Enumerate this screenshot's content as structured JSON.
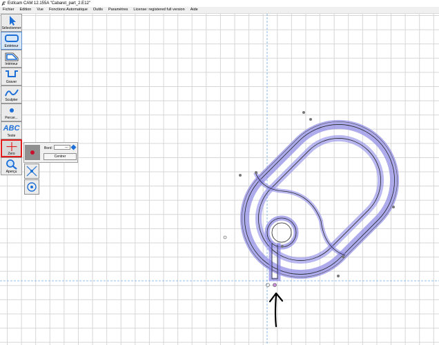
{
  "window": {
    "title": "Estlcam CAM 12.155A \"Cabaret_part_2.E12\"",
    "app_icon": "estlcam-logo-icon"
  },
  "menu": [
    {
      "label": "Fichier"
    },
    {
      "label": "Edition"
    },
    {
      "label": "Vue"
    },
    {
      "label": "Fonctions Automatique"
    },
    {
      "label": "Outils"
    },
    {
      "label": "Paramètres"
    },
    {
      "label": "License: registered full version"
    },
    {
      "label": "Aide"
    }
  ],
  "tools": [
    {
      "id": "selectionner",
      "label": "Sélectionner",
      "icon": "cursor-arrow-icon",
      "active": false
    },
    {
      "id": "exterieur",
      "label": "Extérieur",
      "icon": "outside-contour-icon",
      "active": true
    },
    {
      "id": "interieur",
      "label": "Intérieur",
      "icon": "inside-contour-icon",
      "active": false
    },
    {
      "id": "graver",
      "label": "Graver",
      "icon": "engrave-icon",
      "active": false
    },
    {
      "id": "sculpter",
      "label": "Sculpter",
      "icon": "sculpt-icon",
      "active": false
    },
    {
      "id": "percer",
      "label": "Percer...",
      "icon": "drill-icon",
      "active": false
    },
    {
      "id": "texte",
      "label": "Texte",
      "icon": "text-abc-icon",
      "glyph": "ABC",
      "active": false
    },
    {
      "id": "zero",
      "label": "Zero",
      "icon": "zero-crosshair-icon",
      "active": false,
      "highlighted": true
    },
    {
      "id": "apercu",
      "label": "Aperçu",
      "icon": "magnifier-icon",
      "active": false
    }
  ],
  "zero_panel": {
    "bord_label": "Bord:",
    "bord_value": "---",
    "centrer_label": "Centrer",
    "buttons": [
      {
        "icon": "red-dot-icon",
        "selected": true
      },
      {
        "icon": "cross-diagonal-icon",
        "selected": false
      },
      {
        "icon": "circle-center-icon",
        "selected": false
      }
    ]
  },
  "colors": {
    "toolpath_highlight": "#8c88e6",
    "tool_blue": "#1d6fd8",
    "zero_red": "#e21b1b",
    "origin_axis": "#6aa6e6",
    "grid": "#d5d5d5"
  }
}
